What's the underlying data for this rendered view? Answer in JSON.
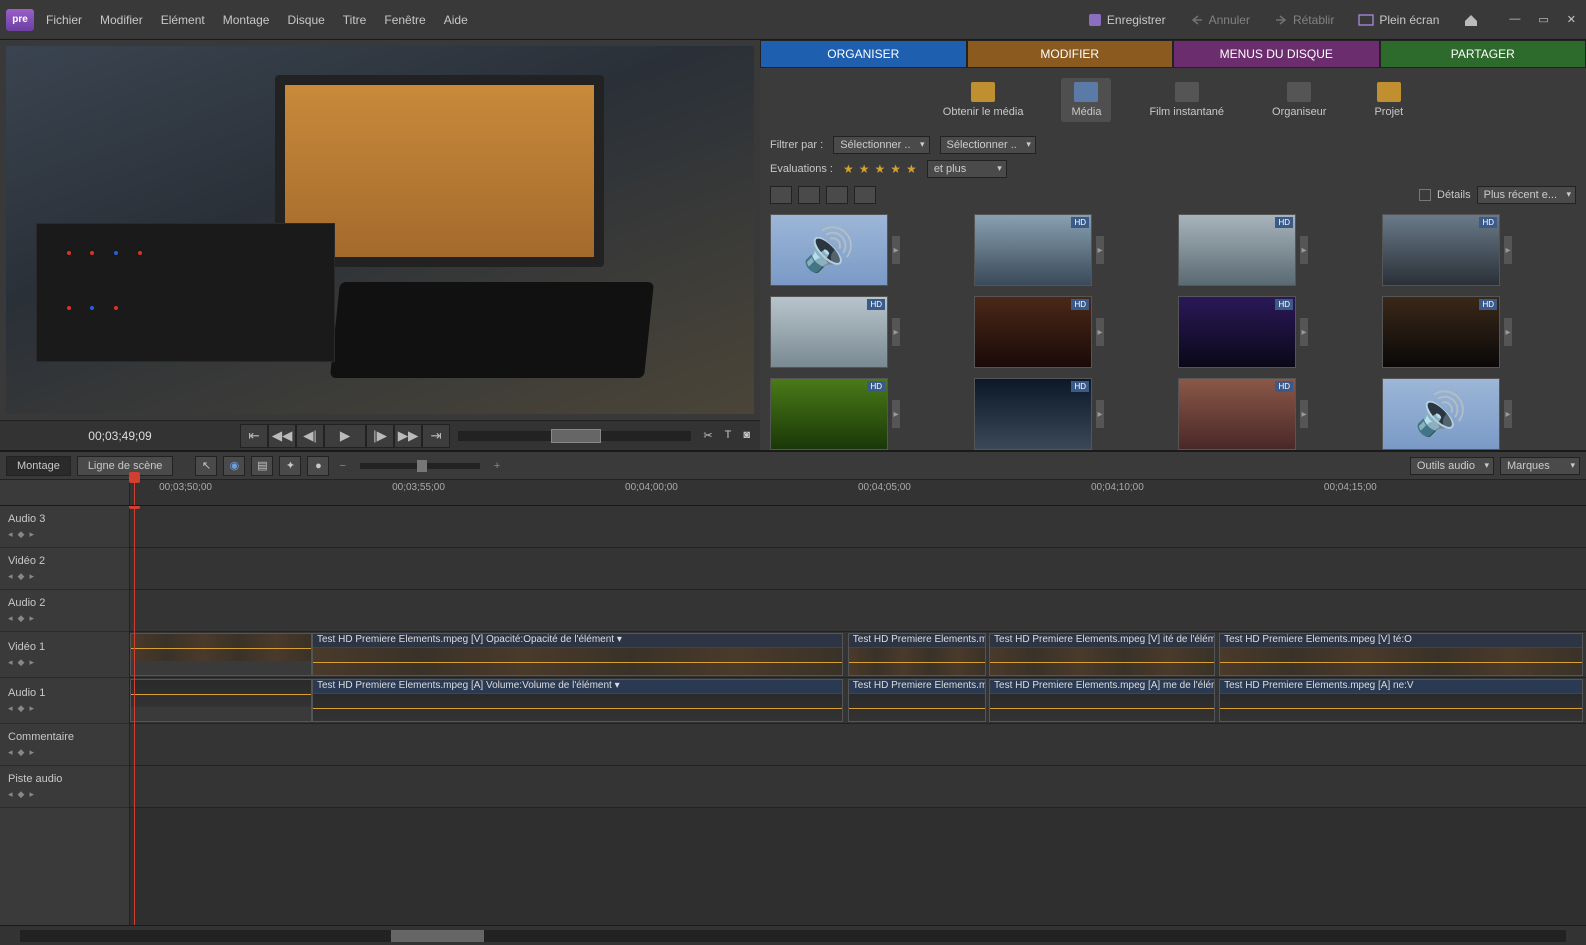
{
  "app": {
    "short_name": "pre"
  },
  "menubar": {
    "items": [
      "Fichier",
      "Modifier",
      "Elément",
      "Montage",
      "Disque",
      "Titre",
      "Fenêtre",
      "Aide"
    ],
    "save": "Enregistrer",
    "undo": "Annuler",
    "redo": "Rétablir",
    "fullscreen": "Plein écran"
  },
  "preview": {
    "timecode": "00;03;49;09"
  },
  "organizer": {
    "tabs": {
      "organize": "ORGANISER",
      "modify": "MODIFIER",
      "disc_menus": "MENUS DU DISQUE",
      "share": "PARTAGER"
    },
    "tools": {
      "get_media": "Obtenir le média",
      "media": "Média",
      "instant_movie": "Film instantané",
      "organizer": "Organiseur",
      "project": "Projet"
    },
    "filter_label": "Filtrer par :",
    "filter_select1": "Sélectionner ..",
    "filter_select2": "Sélectionner ..",
    "ratings_label": "Evaluations :",
    "and_more": "et plus",
    "details_label": "Détails",
    "sort_select": "Plus récent e..."
  },
  "timeline": {
    "tabs": {
      "montage": "Montage",
      "sceneline": "Ligne de scène"
    },
    "audio_tools": "Outils audio",
    "markers": "Marques",
    "ruler": [
      "00;03;50;00",
      "00;03;55;00",
      "00;04;00;00",
      "00;04;05;00",
      "00;04;10;00",
      "00;04;15;00"
    ],
    "tracks": {
      "audio3": "Audio 3",
      "video2": "Vidéo 2",
      "audio2": "Audio 2",
      "video1": "Vidéo 1",
      "audio1": "Audio 1",
      "commentary": "Commentaire",
      "soundtrack": "Piste audio"
    },
    "clip_labels": {
      "v_main": "Test HD Premiere Elements.mpeg [V]",
      "v_opacity": "Opacité:Opacité de l'élément ▾",
      "a_main": "Test HD Premiere Elements.mpeg [A]",
      "a_volume": "Volume:Volume de l'élément ▾",
      "v_short": "Test HD Premiere Elements.mpe",
      "a_short": "Test HD Premiere Elements.mpe",
      "v_trim": "ité de l'élément ▾",
      "a_trim": "me de l'élément ▾",
      "v_end": "té:O",
      "a_end": "ne:V"
    }
  }
}
